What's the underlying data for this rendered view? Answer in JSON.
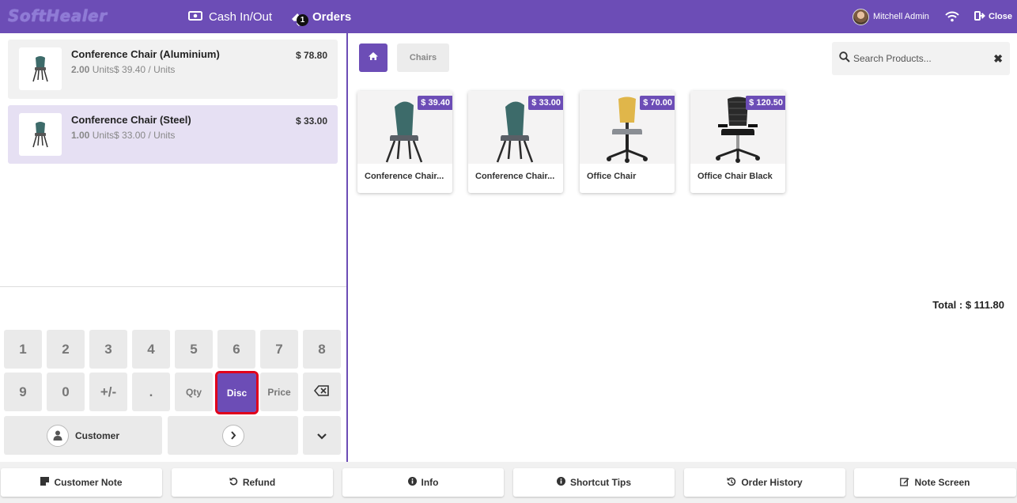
{
  "topbar": {
    "logo": "SoftHealer",
    "cash_label": "Cash In/Out",
    "orders_label": "Orders",
    "orders_count": "1",
    "user_name": "Mitchell Admin",
    "close_label": "Close",
    "bg_color": "#6c4db6"
  },
  "order_lines": [
    {
      "name": "Conference Chair (Aluminium)",
      "qty": "2.00",
      "unit_info": "Units$ 39.40 / Units",
      "price": "$ 78.80"
    },
    {
      "name": "Conference Chair (Steel)",
      "qty": "1.00",
      "unit_info": "Units$ 33.00 / Units",
      "price": "$ 33.00"
    }
  ],
  "total": "Total : $ 111.80",
  "numpad": {
    "row1": [
      "1",
      "2",
      "3",
      "4",
      "5",
      "6",
      "7",
      "8"
    ],
    "row2": [
      "9",
      "0",
      "+/-",
      "."
    ],
    "qty": "Qty",
    "disc": "Disc",
    "price": "Price",
    "customer": "Customer"
  },
  "breadcrumb": {
    "category": "Chairs"
  },
  "search": {
    "placeholder": "Search Products..."
  },
  "products": [
    {
      "name": "Conference Chair (Aluminium)",
      "display_name": "Conference Chair...",
      "price": "$ 39.40"
    },
    {
      "name": "Conference Chair (Steel)",
      "display_name": "Conference Chair...",
      "price": "$ 33.00"
    },
    {
      "name": "Office Chair",
      "display_name": "Office Chair",
      "price": "$ 70.00"
    },
    {
      "name": "Office Chair Black",
      "display_name": "Office Chair Black",
      "price": "$ 120.50"
    }
  ],
  "bottom_buttons": [
    "Customer Note",
    "Refund",
    "Info",
    "Shortcut Tips",
    "Order History",
    "Note Screen"
  ],
  "colors": {
    "accent": "#6c4db6",
    "highlight": "#e0001b",
    "selected_line": "#e6e0f3"
  }
}
